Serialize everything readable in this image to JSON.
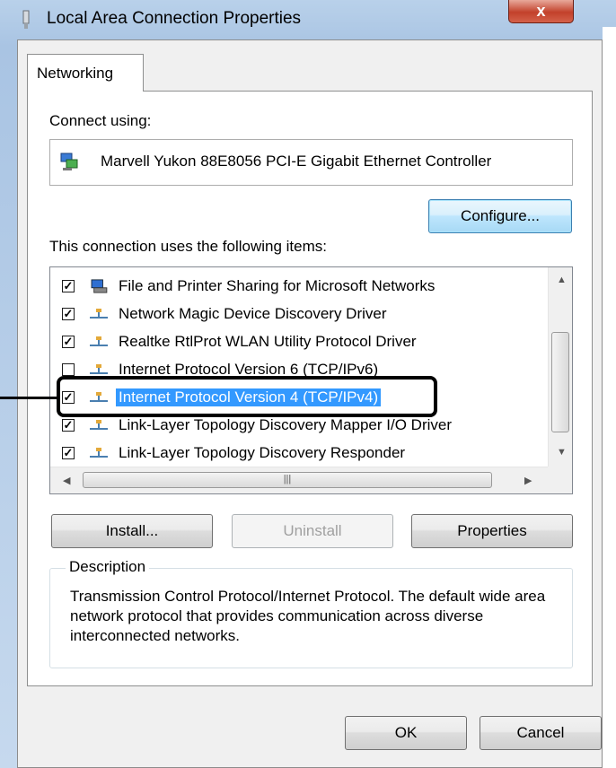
{
  "window": {
    "title": "Local Area Connection Properties",
    "close_symbol": "x"
  },
  "tabs": [
    {
      "label": "Networking",
      "active": true
    }
  ],
  "connect_using": {
    "label": "Connect using:",
    "adapter": "Marvell Yukon 88E8056 PCI-E Gigabit Ethernet Controller",
    "adapter_icon": "network-adapter-icon"
  },
  "buttons": {
    "configure": "Configure...",
    "install": "Install...",
    "uninstall": "Uninstall",
    "properties": "Properties",
    "ok": "OK",
    "cancel": "Cancel"
  },
  "items_label": "This connection uses the following items:",
  "items": [
    {
      "label": "File and Printer Sharing for Microsoft Networks",
      "checked": true,
      "icon": "computer-printer-icon"
    },
    {
      "label": "Network Magic Device Discovery Driver",
      "checked": true,
      "icon": "protocol-icon"
    },
    {
      "label": "Realtke RtlProt WLAN Utility Protocol Driver",
      "checked": true,
      "icon": "protocol-icon"
    },
    {
      "label": "Internet Protocol Version 6 (TCP/IPv6)",
      "checked": false,
      "icon": "protocol-icon"
    },
    {
      "label": "Internet Protocol Version 4 (TCP/IPv4)",
      "checked": true,
      "icon": "protocol-icon",
      "selected": true
    },
    {
      "label": "Link-Layer Topology Discovery Mapper I/O Driver",
      "checked": true,
      "icon": "protocol-icon"
    },
    {
      "label": "Link-Layer Topology Discovery Responder",
      "checked": true,
      "icon": "protocol-icon"
    }
  ],
  "description": {
    "legend": "Description",
    "text": "Transmission Control Protocol/Internet Protocol. The default wide area network protocol that provides communication across diverse interconnected networks."
  },
  "colors": {
    "selection": "#3399ff",
    "window_frame": "#b9d1ea",
    "close_button": "#c2412b"
  }
}
